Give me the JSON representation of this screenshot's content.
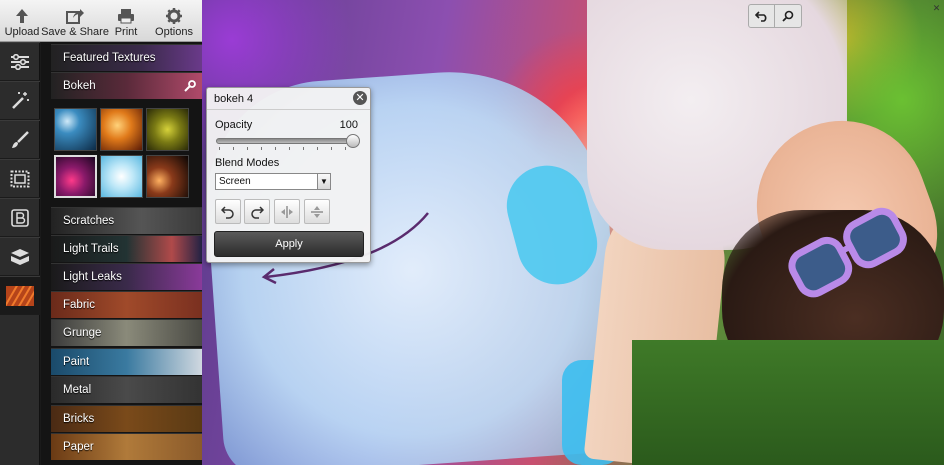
{
  "toolbar": {
    "upload": "Upload",
    "save_share": "Save & Share",
    "print": "Print",
    "options": "Options"
  },
  "tools": [
    {
      "icon": "adjustments-icon"
    },
    {
      "icon": "magic-wand-icon"
    },
    {
      "icon": "brush-icon"
    },
    {
      "icon": "frame-icon"
    },
    {
      "icon": "text-icon"
    },
    {
      "icon": "stickers-icon"
    },
    {
      "icon": "textures-icon",
      "active": true
    }
  ],
  "sidebar": {
    "featured": "Featured Textures",
    "selected": "Bokeh",
    "categories": [
      "Scratches",
      "Light Trails",
      "Light Leaks",
      "Fabric",
      "Grunge",
      "Paint",
      "Metal",
      "Bricks",
      "Paper"
    ]
  },
  "dialog": {
    "title": "bokeh 4",
    "opacity_label": "Opacity",
    "opacity_value": "100",
    "opacity_fraction": 1.0,
    "blend_label": "Blend Modes",
    "blend_value": "Screen",
    "apply_label": "Apply"
  },
  "colors": {
    "toolbar_bg": "#e6e6e6",
    "panel_bg": "#141414",
    "apply_bg": "#3a3a3a"
  }
}
